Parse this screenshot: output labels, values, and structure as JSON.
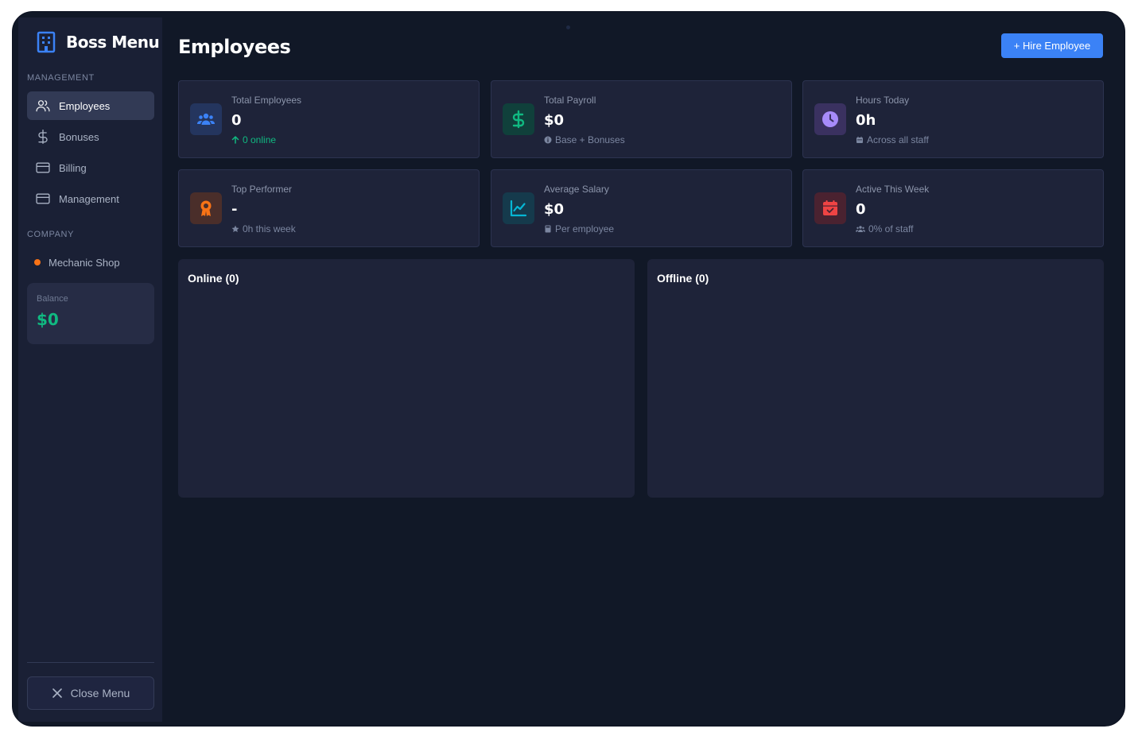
{
  "sidebar": {
    "brand_title": "Boss Menu",
    "management_label": "MANAGEMENT",
    "items": [
      {
        "label": "Employees",
        "icon": "users-icon",
        "active": true
      },
      {
        "label": "Bonuses",
        "icon": "dollar-icon",
        "active": false
      },
      {
        "label": "Billing",
        "icon": "card-icon",
        "active": false
      },
      {
        "label": "Management",
        "icon": "card-icon",
        "active": false
      }
    ],
    "company_label": "COMPANY",
    "company_name": "Mechanic Shop",
    "balance_label": "Balance",
    "balance_value": "$0",
    "close_label": "Close Menu"
  },
  "header": {
    "title": "Employees",
    "hire_button": "+ Hire Employee"
  },
  "stats": [
    {
      "label": "Total Employees",
      "value": "0",
      "sub": "0 online",
      "icon": "users-icon",
      "color": "#3b82f6"
    },
    {
      "label": "Total Payroll",
      "value": "$0",
      "sub": "Base + Bonuses",
      "icon": "dollar-icon",
      "color": "#10b981"
    },
    {
      "label": "Hours Today",
      "value": "0h",
      "sub": "Across all staff",
      "icon": "clock-icon",
      "color": "#a78bfa"
    },
    {
      "label": "Top Performer",
      "value": "-",
      "sub": "0h this week",
      "icon": "award-icon",
      "color": "#f97316"
    },
    {
      "label": "Average Salary",
      "value": "$0",
      "sub": "Per employee",
      "icon": "chart-line-icon",
      "color": "#06b6d4"
    },
    {
      "label": "Active This Week",
      "value": "0",
      "sub": "0% of staff",
      "icon": "calendar-check-icon",
      "color": "#ef4444"
    }
  ],
  "panels": {
    "online_title": "Online (0)",
    "offline_title": "Offline (0)"
  }
}
